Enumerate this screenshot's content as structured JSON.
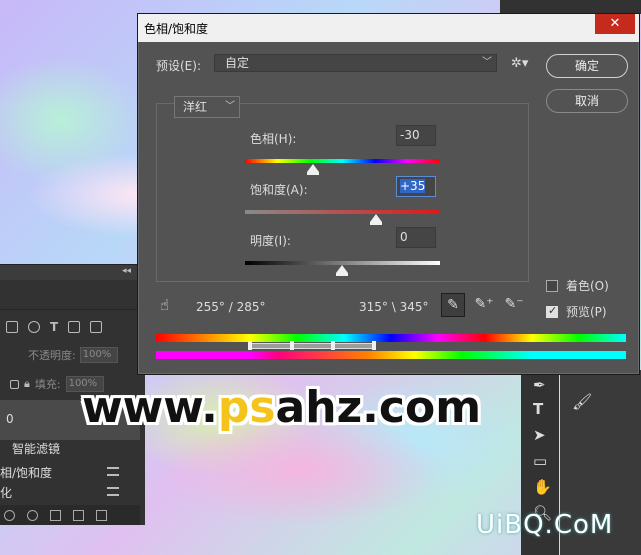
{
  "dialog": {
    "title": "色相/饱和度",
    "close": "✕",
    "preset_label": "预设(E):",
    "preset_value": "自定",
    "ok_label": "确定",
    "cancel_label": "取消",
    "channel": "洋红",
    "hue_label": "色相(H):",
    "hue_value": "-30",
    "saturation_label": "饱和度(A):",
    "saturation_value": "+35",
    "lightness_label": "明度(I):",
    "lightness_value": "0",
    "colorize_label": "着色(O)",
    "preview_label": "预览(P)",
    "range_left": "255° / 285°",
    "range_right": "315° \\ 345°"
  },
  "layers_panel": {
    "opacity_label": "不透明度:",
    "opacity_value": "100%",
    "fill_label": "填充:",
    "fill_value": "100%",
    "active_layer": "0",
    "smart_filters": "智能滤镜",
    "filter_item_1": "相/饱和度",
    "filter_item_2": "化"
  },
  "watermark": {
    "main_prefix": "www.",
    "main_accent": "ps",
    "main_suffix": "ahz.com",
    "corner": "UiBQ.CoM"
  }
}
